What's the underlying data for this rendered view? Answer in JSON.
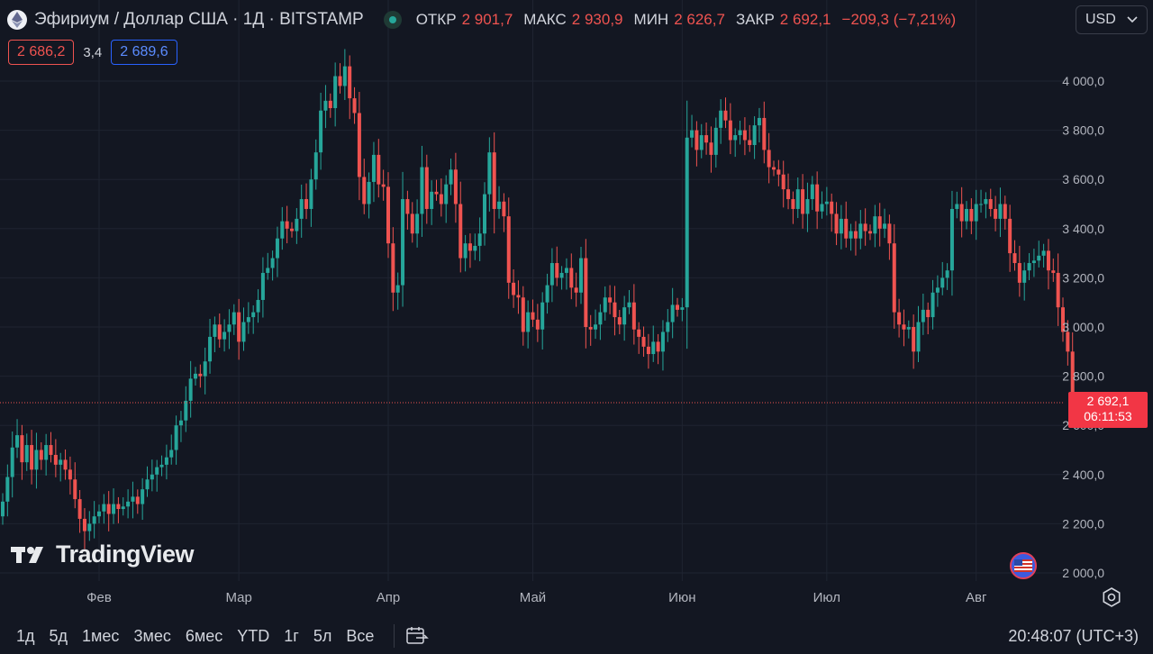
{
  "header": {
    "title": "Эфириум / Доллар США · 1Д · BITSTAMP",
    "ohlc": [
      {
        "label": "ОТКР",
        "value": "2 901,7"
      },
      {
        "label": "МАКС",
        "value": "2 930,9"
      },
      {
        "label": "МИН",
        "value": "2 626,7"
      },
      {
        "label": "ЗАКР",
        "value": "2 692,1"
      }
    ],
    "change": "−209,3 (−7,21%)",
    "currency": "USD"
  },
  "quote": {
    "bid": "2 686,2",
    "spread": "3,4",
    "ask": "2 689,6"
  },
  "logo_text": "TradingView",
  "last_price": {
    "value": "2 692,1",
    "countdown": "06:11:53"
  },
  "colors": {
    "up": "#26a69a",
    "down": "#ef5350",
    "background": "#131722",
    "grid": "#1f2431",
    "axis_text": "#b2b5be"
  },
  "icons": [
    "ethereum-icon",
    "market-status-icon",
    "chevron-down-icon",
    "us-flag-icon",
    "settings-icon",
    "date-range-icon"
  ],
  "bottom_bar": {
    "ranges": [
      "1д",
      "5д",
      "1мес",
      "3мес",
      "6мес",
      "YTD",
      "1г",
      "5л",
      "Все"
    ],
    "clock": "20:48:07 (UTC+3)"
  },
  "chart_data": {
    "type": "candlestick",
    "series_name": "ETH/USD",
    "y_ticks": [
      2000,
      2200,
      2400,
      2600,
      2800,
      3000,
      3200,
      3400,
      3600,
      3800,
      4000
    ],
    "y_tick_labels": [
      "2 000,0",
      "2 200,0",
      "2 400,0",
      "2 600,0",
      "2 800,0",
      "3 000,0",
      "3 200,0",
      "3 400,0",
      "3 600,0",
      "3 800,0",
      "4 000,0"
    ],
    "ylim": [
      1960,
      4100
    ],
    "x_labels": [
      {
        "label": "Фев",
        "date": "2024-02-01"
      },
      {
        "label": "Мар",
        "date": "2024-03-01"
      },
      {
        "label": "Апр",
        "date": "2024-04-01"
      },
      {
        "label": "Май",
        "date": "2024-05-01"
      },
      {
        "label": "Июн",
        "date": "2024-06-01"
      },
      {
        "label": "Июл",
        "date": "2024-07-01"
      },
      {
        "label": "Авг",
        "date": "2024-08-01"
      }
    ],
    "grid": true,
    "last_close": 2692.1,
    "closes": [
      2290,
      2390,
      2510,
      2560,
      2450,
      2520,
      2420,
      2500,
      2460,
      2520,
      2480,
      2440,
      2460,
      2420,
      2380,
      2300,
      2220,
      2170,
      2200,
      2230,
      2250,
      2280,
      2240,
      2280,
      2260,
      2270,
      2290,
      2310,
      2280,
      2340,
      2380,
      2400,
      2430,
      2440,
      2470,
      2500,
      2600,
      2620,
      2700,
      2790,
      2810,
      2800,
      2860,
      2960,
      3010,
      2950,
      2980,
      3010,
      3060,
      2940,
      3020,
      3040,
      3060,
      3110,
      3220,
      3240,
      3280,
      3360,
      3430,
      3400,
      3390,
      3440,
      3520,
      3480,
      3600,
      3710,
      3880,
      3920,
      3890,
      4020,
      3980,
      4060,
      3930,
      3870,
      3610,
      3500,
      3590,
      3700,
      3580,
      3570,
      3340,
      3140,
      3170,
      3520,
      3460,
      3380,
      3460,
      3650,
      3480,
      3550,
      3540,
      3500,
      3580,
      3640,
      3500,
      3280,
      3340,
      3310,
      3330,
      3380,
      3540,
      3710,
      3480,
      3510,
      3450,
      3180,
      3130,
      3120,
      2980,
      3060,
      3030,
      2990,
      3100,
      3170,
      3260,
      3200,
      3220,
      3240,
      3160,
      3140,
      3280,
      3000,
      2990,
      3010,
      3060,
      3120,
      3100,
      3040,
      3010,
      3080,
      3100,
      2990,
      2960,
      2920,
      2890,
      2940,
      2900,
      2980,
      3020,
      3090,
      3070,
      3080,
      3770,
      3800,
      3720,
      3780,
      3750,
      3700,
      3810,
      3880,
      3840,
      3760,
      3780,
      3800,
      3760,
      3740,
      3820,
      3850,
      3720,
      3650,
      3640,
      3620,
      3560,
      3520,
      3480,
      3560,
      3460,
      3520,
      3580,
      3470,
      3500,
      3510,
      3460,
      3380,
      3440,
      3360,
      3390,
      3360,
      3420,
      3390,
      3380,
      3450,
      3400,
      3420,
      3340,
      3060,
      3010,
      2990,
      3000,
      2900,
      3020,
      3070,
      3040,
      3140,
      3160,
      3200,
      3230,
      3480,
      3500,
      3430,
      3480,
      3430,
      3500,
      3500,
      3520,
      3480,
      3440,
      3500,
      3440,
      3300,
      3260,
      3180,
      3230,
      3260,
      3270,
      3290,
      3310,
      3230,
      3220,
      3080,
      2980,
      2900,
      2692.1
    ]
  }
}
